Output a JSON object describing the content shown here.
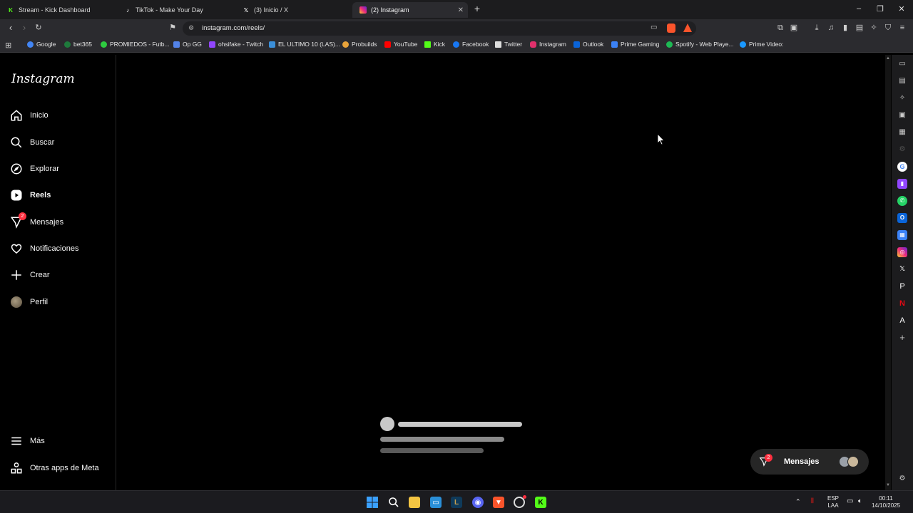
{
  "browser": {
    "tabs": [
      {
        "title": "Stream - Kick Dashboard",
        "icon": "kick-icon",
        "color": "#53fc18"
      },
      {
        "title": "TikTok - Make Your Day",
        "icon": "tiktok-icon",
        "color": "#ffffff"
      },
      {
        "title": "(3) Inicio / X",
        "icon": "x-icon",
        "color": "#ffffff"
      },
      {
        "title": "(2) Instagram",
        "icon": "instagram-icon",
        "color": "#e1306c"
      }
    ],
    "url": "instagram.com/reels/",
    "bookmarks": [
      {
        "label": "Google",
        "color": "#4285f4"
      },
      {
        "label": "bet365",
        "color": "#1e7a3c"
      },
      {
        "label": "PROMIEDOS - Futb...",
        "color": "#2ecc40"
      },
      {
        "label": "Op GG",
        "color": "#5383e8"
      },
      {
        "label": "ohsifake - Twitch",
        "color": "#9146ff"
      },
      {
        "label": "EL ULTIMO 10 (LAS)...",
        "color": "#3b8fd9"
      },
      {
        "label": "Probuilds",
        "color": "#e8a33a"
      },
      {
        "label": "YouTube",
        "color": "#ff0000"
      },
      {
        "label": "Kick",
        "color": "#53fc18"
      },
      {
        "label": "Facebook",
        "color": "#1877f2"
      },
      {
        "label": "Twitter",
        "color": "#ffffff"
      },
      {
        "label": "Instagram",
        "color": "#e1306c"
      },
      {
        "label": "Outlook",
        "color": "#0a64d8"
      },
      {
        "label": "Prime Gaming",
        "color": "#3b82f6"
      },
      {
        "label": "Spotify - Web Playe...",
        "color": "#1db954"
      },
      {
        "label": "Prime Video:",
        "color": "#1a98ff"
      }
    ]
  },
  "instagram": {
    "logo": "Instagram",
    "nav": [
      {
        "label": "Inicio",
        "icon": "home-icon"
      },
      {
        "label": "Buscar",
        "icon": "search-icon"
      },
      {
        "label": "Explorar",
        "icon": "compass-icon"
      },
      {
        "label": "Reels",
        "icon": "reels-icon",
        "active": true
      },
      {
        "label": "Mensajes",
        "icon": "messenger-icon",
        "badge": "2"
      },
      {
        "label": "Notificaciones",
        "icon": "heart-icon"
      },
      {
        "label": "Crear",
        "icon": "plus-icon"
      },
      {
        "label": "Perfil",
        "icon": "avatar"
      }
    ],
    "bottom_nav": [
      {
        "label": "Más",
        "icon": "menu-icon"
      },
      {
        "label": "Otras apps de Meta",
        "icon": "meta-apps-icon"
      }
    ],
    "messages_pill": {
      "label": "Mensajes",
      "badge": "2"
    }
  },
  "taskbar": {
    "lang_line1": "ESP",
    "lang_line2": "LAA",
    "time": "00:11",
    "date": "14/10/2025"
  },
  "colors": {
    "badge": "#ff3040",
    "brave": "#fb542b",
    "kick": "#53fc18"
  }
}
